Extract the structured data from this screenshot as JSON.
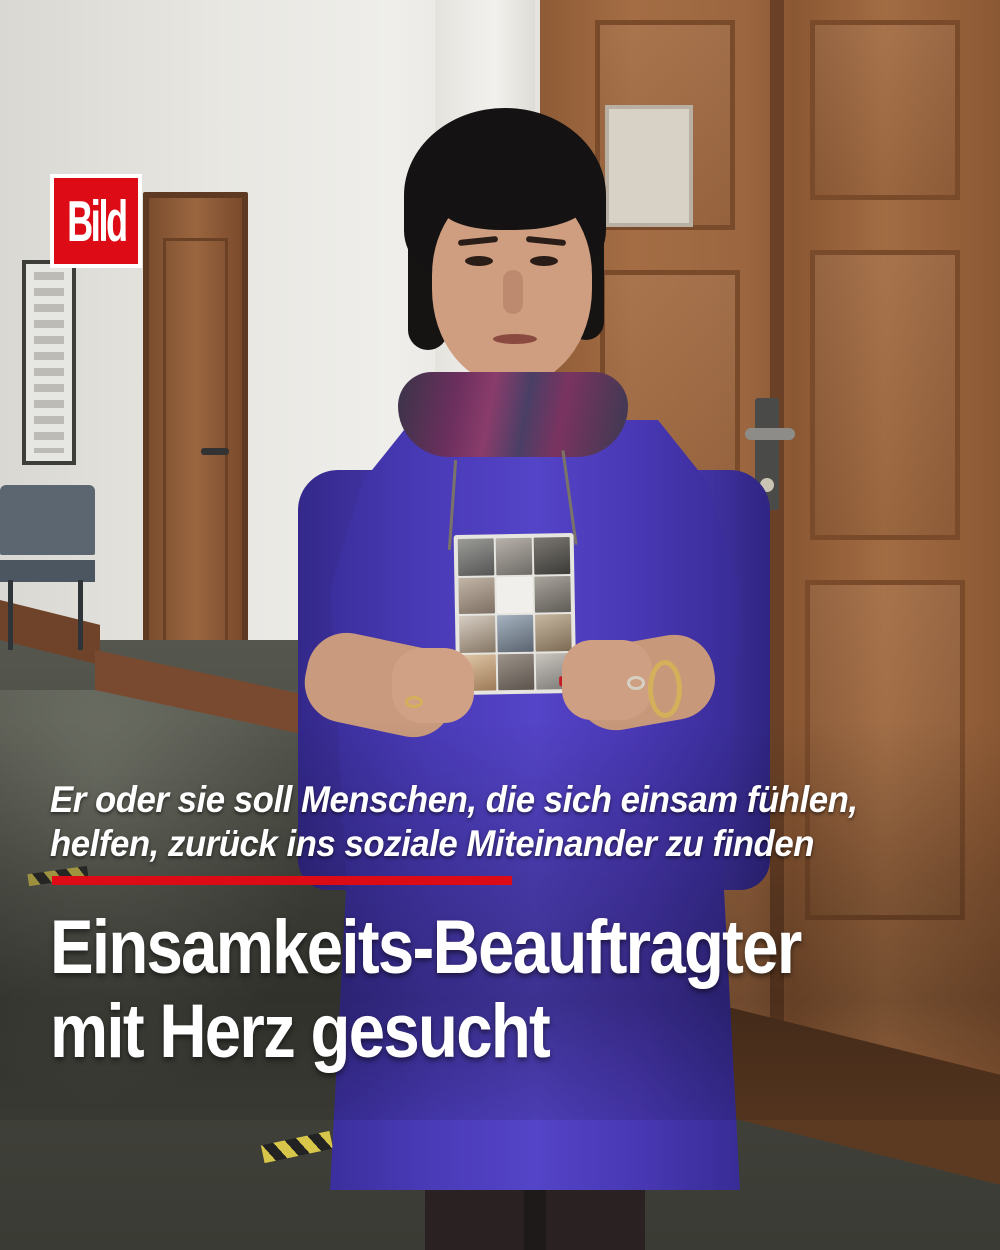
{
  "brand": {
    "logo_text": "Bild",
    "logo_color": "#dd0b16"
  },
  "article": {
    "kicker_lines": [
      "Er oder sie soll Menschen, die sich einsam fühlen,",
      "helfen, zurück ins soziale Miteinander zu finden"
    ],
    "headline_lines": [
      "Einsamkeits-Beauftragter",
      "mit Herz gesucht"
    ],
    "accent_color": "#dd0b16"
  }
}
